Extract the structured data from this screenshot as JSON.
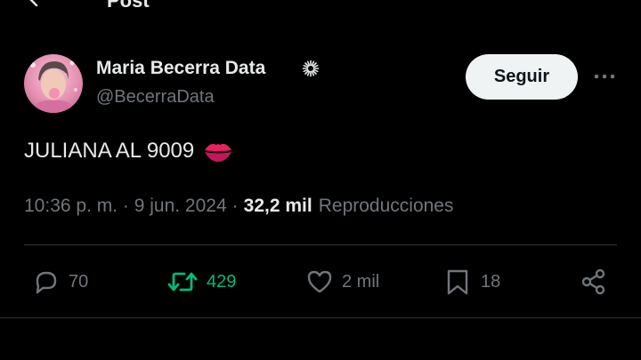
{
  "header": {
    "title": "Post"
  },
  "author": {
    "name": "Maria Becerra Data",
    "handle": "@BecerraData"
  },
  "follow_label": "Seguir",
  "tweet": {
    "text": "JULIANA AL 9009",
    "emoji_icon": "kiss-mark-icon"
  },
  "meta": {
    "timestamp": "10:36 p. m. · 9 jun. 2024",
    "separator": "·",
    "views_count": "32,2 mil",
    "views_label": "Reproducciones"
  },
  "actions": {
    "replies": "70",
    "retweets": "429",
    "likes": "2 mil",
    "bookmarks": "18"
  },
  "colors": {
    "background": "#000000",
    "text_primary": "#e7e9ea",
    "text_secondary": "#71767b",
    "retweet_green": "#00ba7c",
    "divider": "#2f3336",
    "follow_button_bg": "#eff3f4"
  }
}
